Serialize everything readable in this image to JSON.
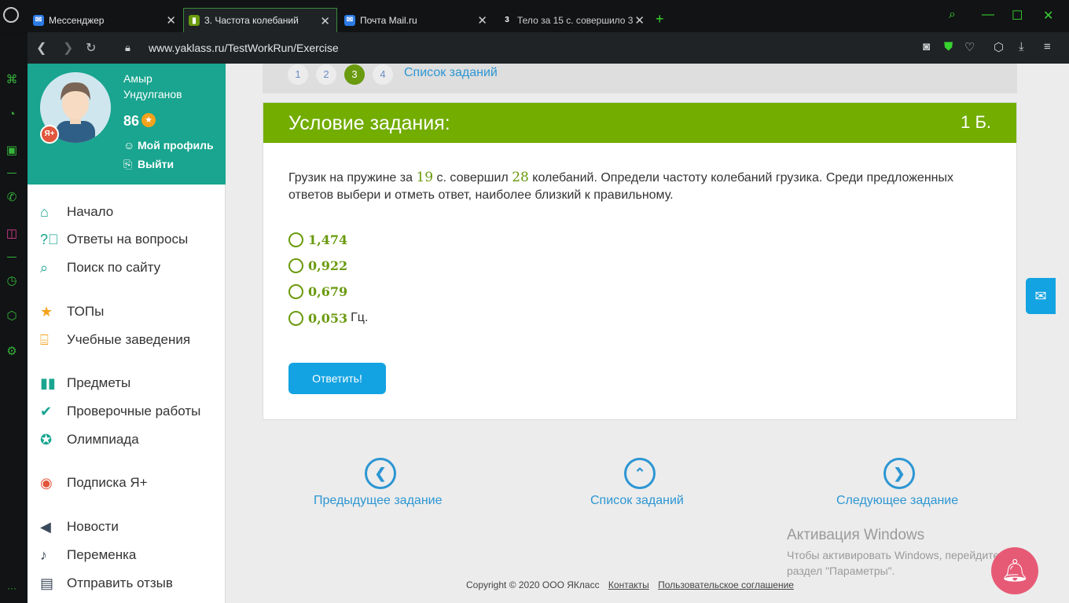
{
  "browser": {
    "tabs": [
      {
        "label": "Мессенджер"
      },
      {
        "label": "3. Частота колебаний"
      },
      {
        "label": "Почта Mail.ru"
      },
      {
        "label": "Тело за 15 с. совершило 3"
      }
    ],
    "url": "www.yaklass.ru/TestWorkRun/Exercise"
  },
  "profile": {
    "first_name": "Амыр",
    "last_name": "Ундулганов",
    "points": "86",
    "badge": "Я+",
    "my_profile": "Мой профиль",
    "logout": "Выйти"
  },
  "menu": [
    {
      "label": "Начало",
      "icon": "home-icon"
    },
    {
      "label": "Ответы на вопросы",
      "icon": "question-icon"
    },
    {
      "label": "Поиск по сайту",
      "icon": "search-icon"
    },
    {
      "label": "ТОПы",
      "icon": "star-icon"
    },
    {
      "label": "Учебные заведения",
      "icon": "institution-icon"
    },
    {
      "label": "Предметы",
      "icon": "book-icon"
    },
    {
      "label": "Проверочные работы",
      "icon": "check-icon"
    },
    {
      "label": "Олимпиада",
      "icon": "medal-icon"
    },
    {
      "label": "Подписка Я+",
      "icon": "subscription-icon"
    },
    {
      "label": "Новости",
      "icon": "megaphone-icon"
    },
    {
      "label": "Переменка",
      "icon": "bell-icon"
    },
    {
      "label": "Отправить отзыв",
      "icon": "feedback-icon"
    }
  ],
  "pager": {
    "pages": [
      "1",
      "2",
      "3",
      "4"
    ],
    "current": "3",
    "task_list": "Список заданий"
  },
  "task": {
    "title": "Условие задания:",
    "score": "1 Б.",
    "text_1": "Грузик на пружине за ",
    "time": "19",
    "text_2": " с. совершил ",
    "count": "28",
    "text_3": " колебаний. Определи частоту колебаний грузика. Среди предложенных ответов выбери и отметь ответ, наиболее близкий к правильному.",
    "options": [
      "1,474",
      "0,922",
      "0,679",
      "0,053"
    ],
    "unit": "Гц.",
    "answer_button": "Ответить!"
  },
  "nav": {
    "prev": "Предыдущее задание",
    "list": "Список заданий",
    "next": "Следующее задание"
  },
  "windows": {
    "title": "Активация Windows",
    "line1": "Чтобы активировать Windows, перейдите",
    "line2": "раздел \"Параметры\"."
  },
  "footer": {
    "copyright": "Copyright © 2020 ООО ЯКласс",
    "contacts": "Контакты",
    "agreement": "Пользовательское соглашение"
  },
  "colors": {
    "accent_green": "#72ad00",
    "teal": "#19a58f",
    "link_blue": "#2c96d3"
  }
}
